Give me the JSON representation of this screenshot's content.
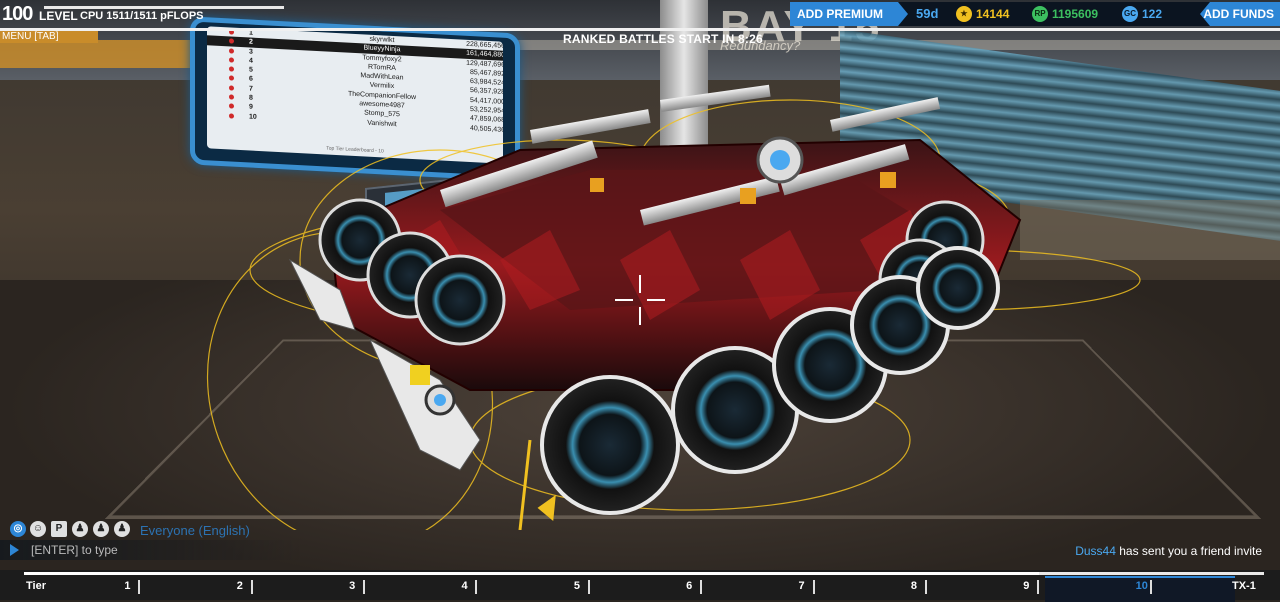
{
  "hud": {
    "level": "100",
    "level_label": "LEVEL",
    "cpu": "CPU 1511/1511 pFLOPS",
    "menu_tab": "MENU [TAB]",
    "ranked_timer": "RANKED BATTLES START IN 8:26"
  },
  "scene": {
    "bay_sign": "BAY 15",
    "bay_subtitle": "Redundancy?"
  },
  "leaderboard": {
    "rows": [
      {
        "rank": "1",
        "name": "skyrwlkt",
        "score": "228,665,456"
      },
      {
        "rank": "2",
        "name": "BlueyyNinja",
        "score": "161,464,880"
      },
      {
        "rank": "3",
        "name": "Tommyfoxy2",
        "score": "129,487,696"
      },
      {
        "rank": "4",
        "name": "RTomRA",
        "score": "85,467,892"
      },
      {
        "rank": "5",
        "name": "MadWithLean",
        "score": "63,984,524"
      },
      {
        "rank": "6",
        "name": "Vermilix",
        "score": "56,357,928"
      },
      {
        "rank": "7",
        "name": "TheCompanionFellow",
        "score": "54,417,000"
      },
      {
        "rank": "8",
        "name": "awesome4987",
        "score": "53,252,954"
      },
      {
        "rank": "9",
        "name": "Stomp_575",
        "score": "47,859,068"
      },
      {
        "rank": "10",
        "name": "Vanishwit",
        "score": "40,505,436"
      }
    ],
    "highlight_index": 1,
    "footer": "Top Tier Leaderboard - 10"
  },
  "currency": {
    "add_premium": "ADD PREMIUM",
    "premium_days": "59d",
    "robits": "14144",
    "robits_icon": "robits-icon",
    "rp": "1195609",
    "rp_icon_text": "RP",
    "gc": "122",
    "gc_icon_text": "GC",
    "add_funds": "ADD FUNDS",
    "colors": {
      "accent": "#2d86d6",
      "robits": "#f0c020",
      "rp": "#3cc060",
      "gc": "#4aa8f0"
    }
  },
  "chat": {
    "channel": "Everyone (English)",
    "placeholder": "[ENTER] to type",
    "icons": [
      "globe-icon",
      "accessibility-icon",
      "party-icon",
      "clan-icon",
      "friends-icon",
      "custom-game-icon"
    ]
  },
  "notification": {
    "user": "Duss44",
    "message": " has sent you a friend invite"
  },
  "tiers": {
    "labels": [
      "Tier",
      "1",
      "2",
      "3",
      "4",
      "5",
      "6",
      "7",
      "8",
      "9",
      "10",
      "TX-1"
    ],
    "current": "10",
    "progress": 0.82
  }
}
